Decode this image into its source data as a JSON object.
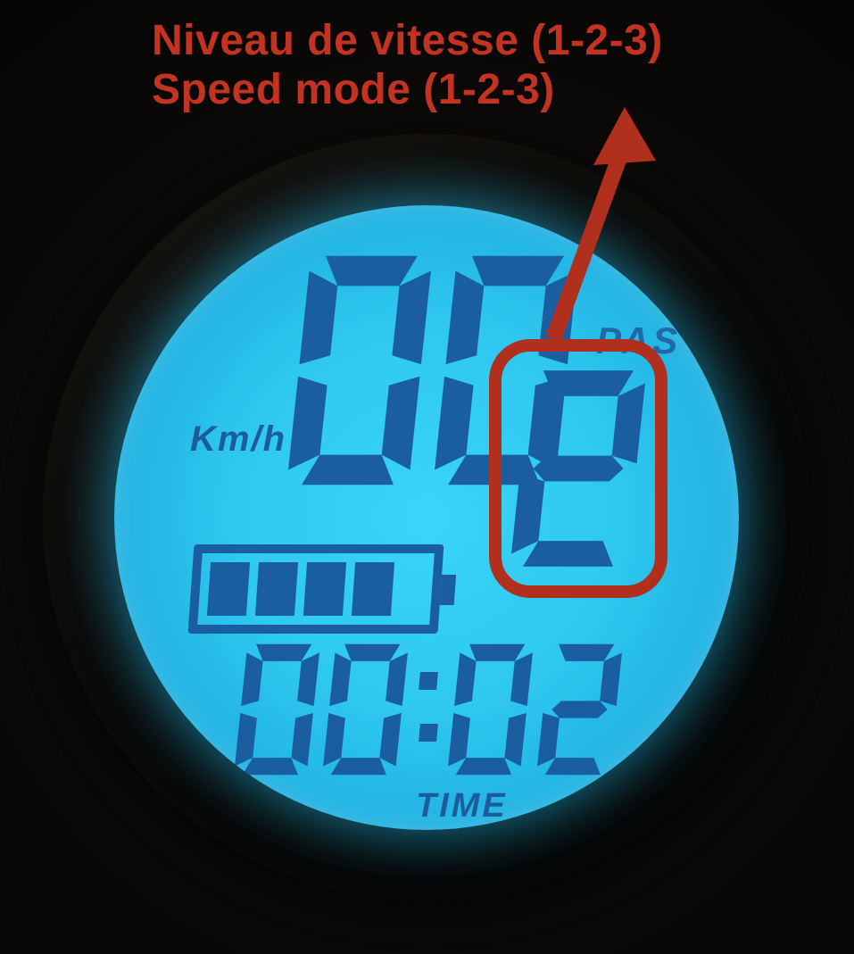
{
  "annotation": {
    "line1": "Niveau de vitesse (1-2-3)",
    "line2": "Speed mode (1-2-3)"
  },
  "display": {
    "unit_label": "Km/h",
    "pas_label": "PAS",
    "time_label": "TIME",
    "speed_value": "00",
    "pas_value": "2",
    "time_value": "00:02",
    "battery_bars": 4,
    "battery_max_bars": 4
  },
  "colors": {
    "lcd_bg": "#2ec7f0",
    "segment": "#1a5ea0",
    "annotation": "#c23321"
  }
}
